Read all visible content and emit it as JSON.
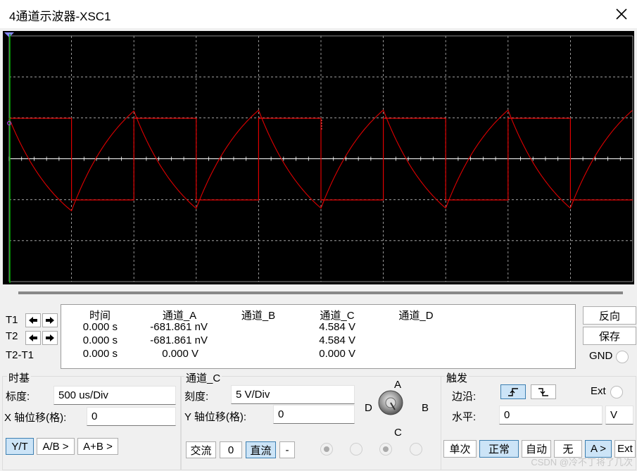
{
  "window": {
    "title": "4通道示波器-XSC1"
  },
  "readout": {
    "headers": [
      "时间",
      "通道_A",
      "通道_B",
      "通道_C",
      "通道_D"
    ],
    "rows": [
      {
        "label": "T1",
        "time": "0.000 s",
        "a": "-681.861 nV",
        "b": "",
        "c": "4.584 V",
        "d": ""
      },
      {
        "label": "T2",
        "time": "0.000 s",
        "a": "-681.861 nV",
        "b": "",
        "c": "4.584 V",
        "d": ""
      },
      {
        "label": "T2-T1",
        "time": "0.000 s",
        "a": "0.000 V",
        "b": "",
        "c": "0.000 V",
        "d": ""
      }
    ]
  },
  "side_buttons": {
    "reverse": "反向",
    "save": "保存",
    "gnd": "GND"
  },
  "timebase": {
    "title": "时基",
    "scale_label": "标度:",
    "scale_value": "500 us/Div",
    "xpos_label": "X 轴位移(格):",
    "xpos_value": "0",
    "modes": [
      "Y/T",
      "A/B >",
      "A+B >"
    ]
  },
  "channel": {
    "title": "通道_C",
    "scale_label": "刻度:",
    "scale_value": "5  V/Div",
    "ypos_label": "Y 轴位移(格):",
    "ypos_value": "0",
    "coupling": [
      "交流",
      "0",
      "直流",
      "-"
    ],
    "knob_labels": {
      "a": "A",
      "b": "B",
      "c": "C",
      "d": "D"
    }
  },
  "trigger": {
    "title": "触发",
    "edge_label": "边沿:",
    "ext_label": "Ext",
    "level_label": "水平:",
    "level_value": "0",
    "level_unit": "V",
    "modes": [
      "单次",
      "正常",
      "自动",
      "无",
      "A >",
      "Ext"
    ]
  },
  "colors": {
    "trace": "#e00000",
    "screen_bg": "#000000",
    "grid": "#bbbbbb",
    "selected": "#cce4f7"
  },
  "watermark": "CSDN @冷不丁将了几次"
}
